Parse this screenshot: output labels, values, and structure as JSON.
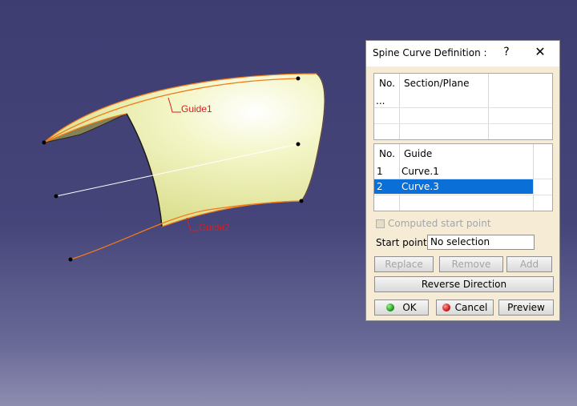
{
  "viewport": {
    "labels": {
      "guide1": "Guide1",
      "guide2": "Guide2"
    },
    "colors": {
      "surface": "#f0f4b0",
      "curve": "#f07a1a",
      "label": "#d42020"
    }
  },
  "dialog": {
    "title": "Spine Curve Definition :",
    "help_icon": "?",
    "close_icon": "✕",
    "sections_list": {
      "headers": {
        "no": "No.",
        "section": "Section/Plane"
      },
      "rows": [
        {
          "no": "...",
          "name": ""
        }
      ]
    },
    "guides_list": {
      "headers": {
        "no": "No.",
        "guide": "Guide"
      },
      "rows": [
        {
          "no": "1",
          "name": "Curve.1"
        },
        {
          "no": "2",
          "name": "Curve.3"
        }
      ],
      "selected_index": 1
    },
    "computed_start_label": "Computed start point",
    "start_point_label": "Start point:",
    "start_point_value": "No selection",
    "buttons": {
      "replace": "Replace",
      "remove": "Remove",
      "add": "Add",
      "reverse": "Reverse Direction",
      "ok": "OK",
      "cancel": "Cancel",
      "preview": "Preview"
    },
    "colors": {
      "selection": "#0a6fd6",
      "panel": "#f6ecd6"
    }
  }
}
